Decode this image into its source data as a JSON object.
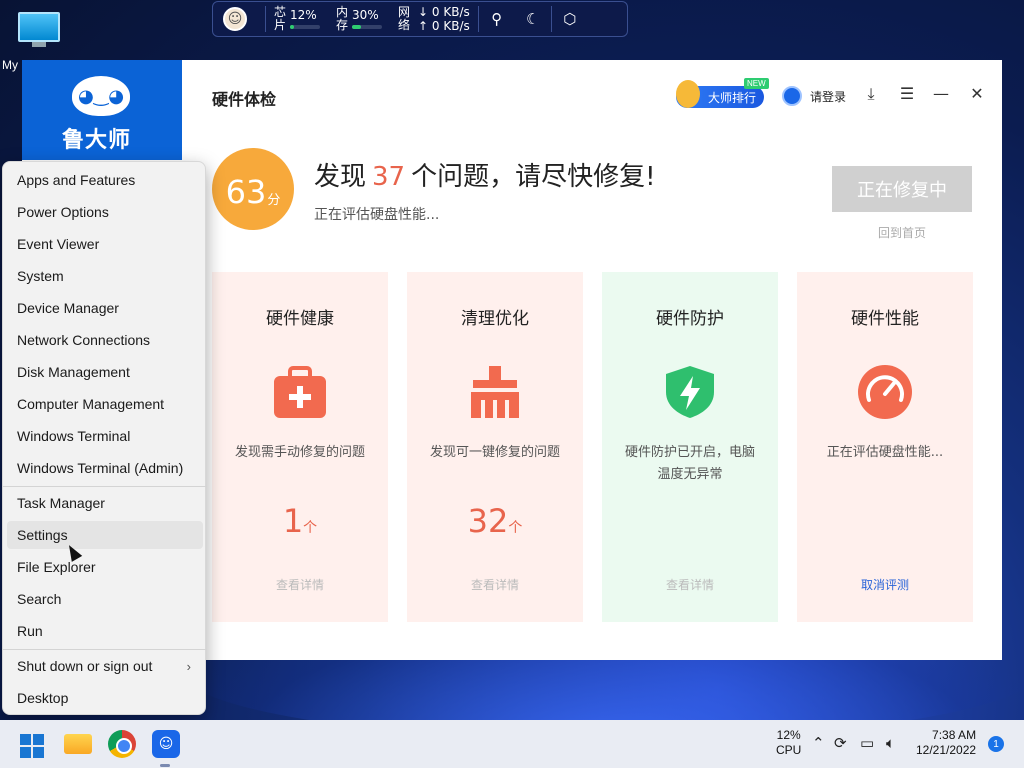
{
  "desktop": {
    "icon_label": "My"
  },
  "widget": {
    "cpu_label_1": "芯",
    "cpu_label_2": "片",
    "cpu_value": "12%",
    "cpu_fill": 0.12,
    "mem_label_1": "内",
    "mem_label_2": "存",
    "mem_value": "30%",
    "mem_fill": 0.3,
    "net_label_1": "网",
    "net_label_2": "络",
    "down": "↓ 0 KB/s",
    "up": "↑ 0 KB/s",
    "icons": [
      "rocket-icon",
      "moon-icon",
      "settings-hex-icon"
    ]
  },
  "app": {
    "logo_text": "鲁大师",
    "title": "硬件体检",
    "rank_label": "大师排行",
    "new_badge": "NEW",
    "login_label": "请登录",
    "score_value": "63",
    "score_unit": "分",
    "headline_pre": "发现",
    "headline_count": "37",
    "headline_post": "个问题，请尽快修复!",
    "subline": "正在评估硬盘性能...",
    "fix_button": "正在修复中",
    "back_link": "回到首页",
    "cards": [
      {
        "title": "硬件健康",
        "desc": "发现需手动修复的问题",
        "num": "1",
        "unit": "个",
        "link": "查看详情",
        "icon": "medical-kit-icon"
      },
      {
        "title": "清理优化",
        "desc": "发现可一键修复的问题",
        "num": "32",
        "unit": "个",
        "link": "查看详情",
        "icon": "broom-icon"
      },
      {
        "title": "硬件防护",
        "desc": "硬件防护已开启，电脑温度无异常",
        "link": "查看详情",
        "icon": "shield-bolt-icon"
      },
      {
        "title": "硬件性能",
        "desc": "正在评估硬盘性能...",
        "link": "取消评测",
        "icon": "gauge-icon"
      }
    ]
  },
  "menu": {
    "items": [
      "Apps and Features",
      "Power Options",
      "Event Viewer",
      "System",
      "Device Manager",
      "Network Connections",
      "Disk Management",
      "Computer Management",
      "Windows Terminal",
      "Windows Terminal (Admin)",
      "Task Manager",
      "Settings",
      "File Explorer",
      "Search",
      "Run",
      "Shut down or sign out",
      "Desktop"
    ],
    "arrow": "›"
  },
  "taskbar": {
    "cpu_value": "12%",
    "cpu_label": "CPU",
    "time": "7:38 AM",
    "date": "12/21/2022",
    "notifications": "1"
  }
}
